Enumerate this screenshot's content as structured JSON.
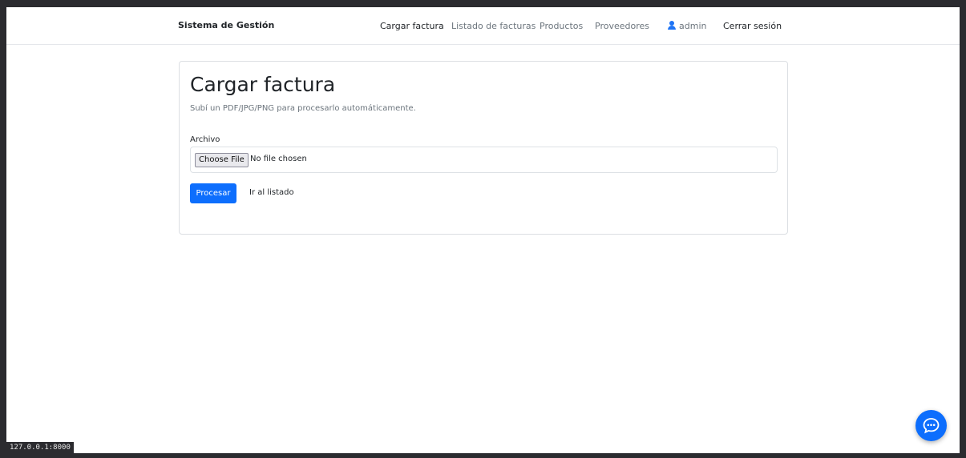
{
  "navbar": {
    "brand": "Sistema de Gestión",
    "links": [
      {
        "label": "Cargar factura",
        "active": true
      },
      {
        "label": "Listado de facturas",
        "active": false
      },
      {
        "label": "Productos",
        "active": false
      },
      {
        "label": "Proveedores",
        "active": false
      }
    ],
    "user": {
      "label": "admin",
      "icon": "user-icon"
    },
    "logout": "Cerrar sesión"
  },
  "card": {
    "title": "Cargar factura",
    "subtitle": "Subí un PDF/JPG/PNG para procesarlo automáticamente.",
    "file_field": {
      "label": "Archivo",
      "button": "Choose File",
      "status": "No file chosen"
    },
    "submit": "Procesar",
    "secondary_link": "Ir al listado"
  },
  "status_bar": {
    "url": "127.0.0.1:8000"
  },
  "chat_button": {
    "icon": "chat-bubble-icon"
  },
  "colors": {
    "primary": "#0d6efd",
    "muted_text": "#6c757d",
    "text": "#212529"
  }
}
